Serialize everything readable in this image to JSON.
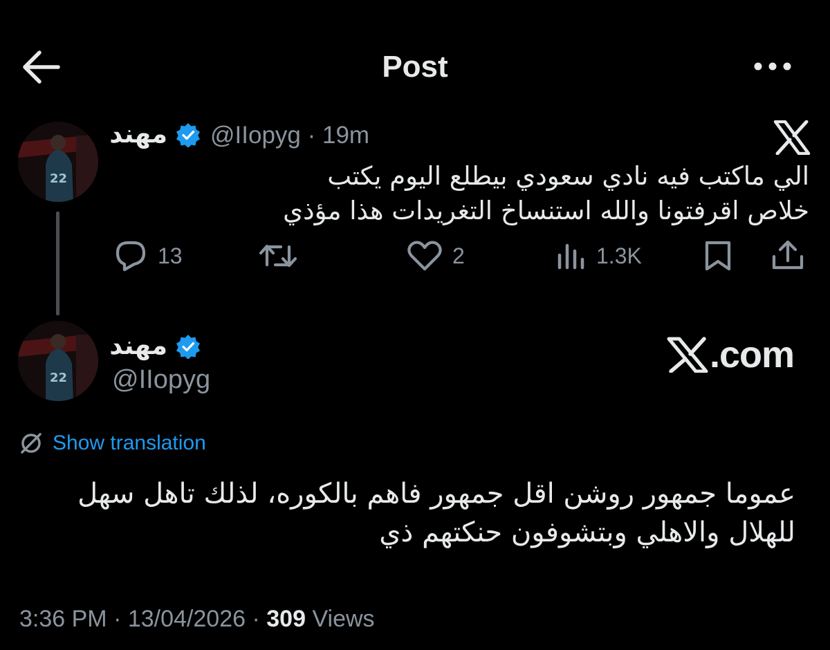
{
  "header": {
    "title": "Post",
    "back_icon": "arrow-left-icon",
    "more_icon": "more-horizontal-icon"
  },
  "quoted_post": {
    "author_name": "مهند",
    "handle": "@IIopyg",
    "separator": "·",
    "time": "19m",
    "text_line1": "الي ماكتب فيه نادي سعودي بيطلع اليوم يكتب",
    "text_line2": "خلاص اقرفتونا والله استنساخ التغريدات هذا مؤذي",
    "replies": "13",
    "likes": "2",
    "views": "1.3K"
  },
  "main_post": {
    "author_name": "مهند",
    "handle": "@IIopyg",
    "watermark": ".com",
    "translation_label": "Show translation",
    "text_line1": "عموما جمهور روشن اقل جمهور فاهم بالكوره، لذلك تاهل سهل",
    "text_line2": "للهلال والاهلي وبتشوفون حنكتهم ذي",
    "time": "3:36 PM",
    "date": "13/04/2026",
    "views_count": "309",
    "views_label": "Views",
    "separator": "·"
  },
  "colors": {
    "background": "#000000",
    "text": "#e7e9ea",
    "muted": "#8b949e",
    "link": "#1d9bf0",
    "verified": "#1d9bf0"
  }
}
